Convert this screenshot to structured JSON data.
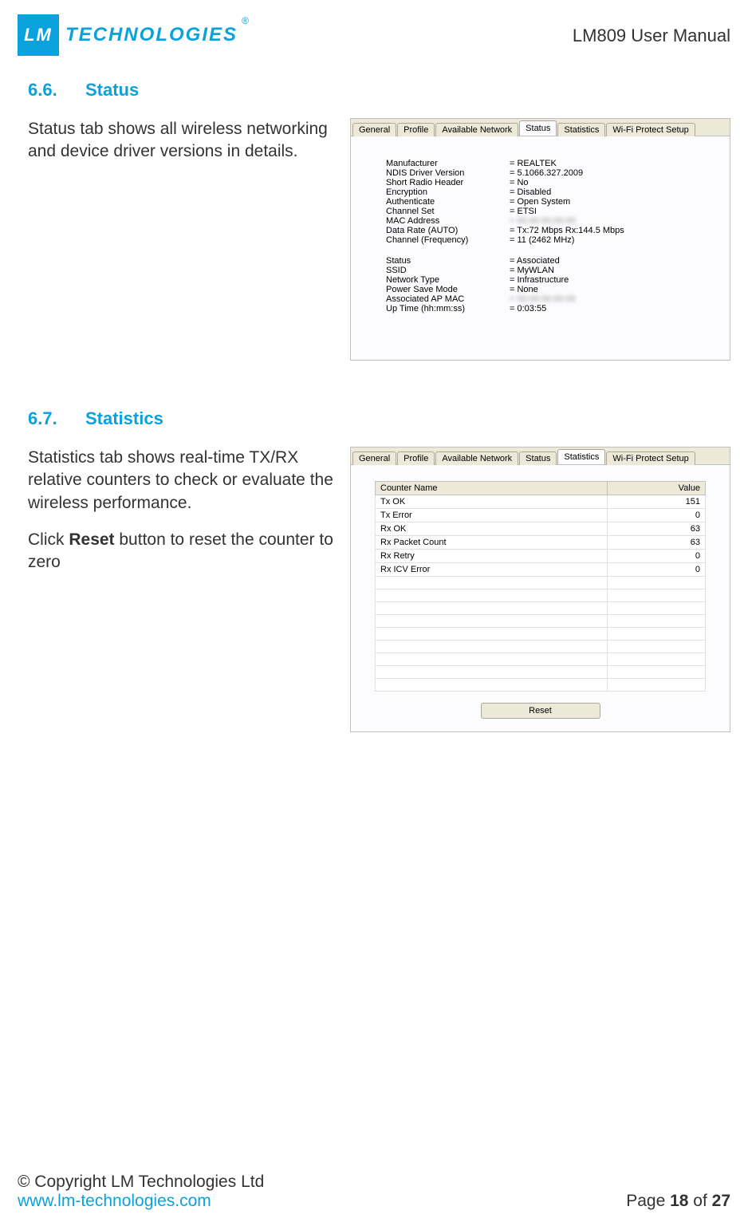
{
  "header": {
    "logo_initials": "LM",
    "logo_word": "TECHNOLOGIES",
    "reg": "®",
    "doc_title": "LM809 User Manual"
  },
  "section1": {
    "num": "6.6.",
    "title": "Status",
    "desc": "Status tab shows all wireless networking and device driver versions in details.",
    "tabs": [
      "General",
      "Profile",
      "Available Network",
      "Status",
      "Statistics",
      "Wi-Fi Protect Setup"
    ],
    "active_tab": "Status",
    "kv_group1": [
      {
        "k": "Manufacturer",
        "v": "REALTEK"
      },
      {
        "k": "NDIS Driver Version",
        "v": "5.1066.327.2009"
      },
      {
        "k": "Short Radio Header",
        "v": "No"
      },
      {
        "k": "Encryption",
        "v": "Disabled"
      },
      {
        "k": "Authenticate",
        "v": "Open System"
      },
      {
        "k": "Channel Set",
        "v": "ETSI"
      },
      {
        "k": "MAC Address",
        "v": "",
        "blur": true
      },
      {
        "k": "Data Rate (AUTO)",
        "v": "Tx:72 Mbps Rx:144.5 Mbps"
      },
      {
        "k": "Channel (Frequency)",
        "v": "11 (2462 MHz)"
      }
    ],
    "kv_group2": [
      {
        "k": "Status",
        "v": "Associated"
      },
      {
        "k": "SSID",
        "v": "MyWLAN"
      },
      {
        "k": "Network Type",
        "v": "Infrastructure"
      },
      {
        "k": "Power Save Mode",
        "v": "None"
      },
      {
        "k": "Associated AP MAC",
        "v": "",
        "blur": true
      },
      {
        "k": "Up Time (hh:mm:ss)",
        "v": "0:03:55"
      }
    ]
  },
  "section2": {
    "num": "6.7.",
    "title": "Statistics",
    "desc1": "Statistics tab shows real-time TX/RX relative counters to check or evaluate the wireless performance.",
    "desc2_pre": "Click ",
    "desc2_bold": "Reset",
    "desc2_post": " button to reset the counter to zero",
    "tabs": [
      "General",
      "Profile",
      "Available Network",
      "Status",
      "Statistics",
      "Wi-Fi Protect Setup"
    ],
    "active_tab": "Statistics",
    "table_headers": [
      "Counter Name",
      "Value"
    ],
    "rows": [
      {
        "name": "Tx OK",
        "value": "151"
      },
      {
        "name": "Tx Error",
        "value": "0"
      },
      {
        "name": "Rx OK",
        "value": "63"
      },
      {
        "name": "Rx Packet Count",
        "value": "63"
      },
      {
        "name": "Rx Retry",
        "value": "0"
      },
      {
        "name": "Rx ICV Error",
        "value": "0"
      }
    ],
    "reset_label": "Reset"
  },
  "footer": {
    "copy": "© Copyright LM Technologies Ltd",
    "url": "www.lm-technologies.com",
    "page_pre": "Page ",
    "page_cur": "18",
    "page_mid": " of ",
    "page_tot": "27"
  }
}
